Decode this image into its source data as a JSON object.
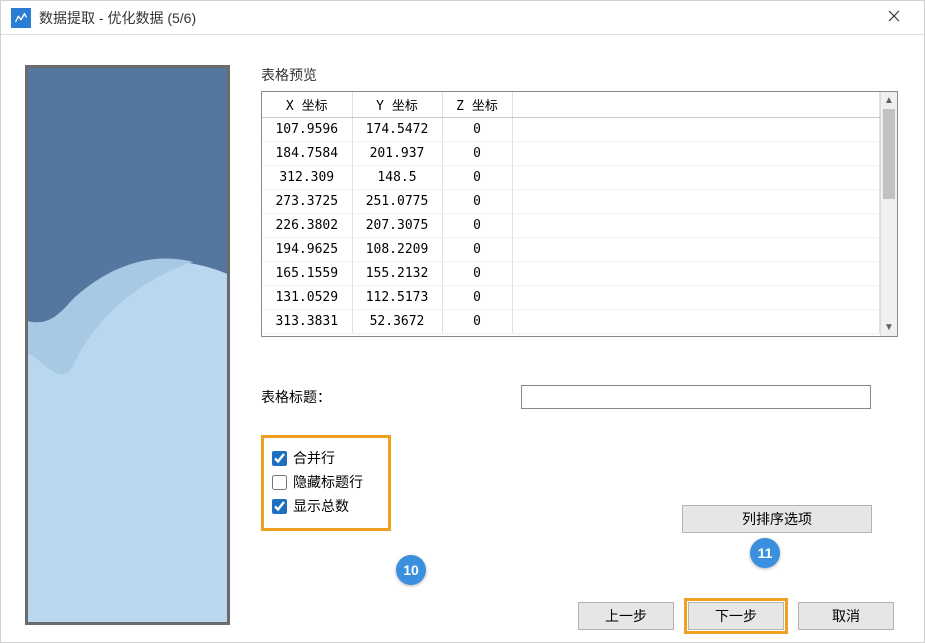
{
  "window": {
    "title": "数据提取 - 优化数据 (5/6)"
  },
  "preview": {
    "label": "表格预览"
  },
  "table": {
    "headers": {
      "x": "X 坐标",
      "y": "Y 坐标",
      "z": "Z 坐标"
    },
    "rows": [
      {
        "x": "107.9596",
        "y": "174.5472",
        "z": "0"
      },
      {
        "x": "184.7584",
        "y": "201.937",
        "z": "0"
      },
      {
        "x": "312.309",
        "y": "148.5",
        "z": "0"
      },
      {
        "x": "273.3725",
        "y": "251.0775",
        "z": "0"
      },
      {
        "x": "226.3802",
        "y": "207.3075",
        "z": "0"
      },
      {
        "x": "194.9625",
        "y": "108.2209",
        "z": "0"
      },
      {
        "x": "165.1559",
        "y": "155.2132",
        "z": "0"
      },
      {
        "x": "131.0529",
        "y": "112.5173",
        "z": "0"
      },
      {
        "x": "313.3831",
        "y": "52.3672",
        "z": "0"
      }
    ]
  },
  "form": {
    "title_label": "表格标题：",
    "title_value": ""
  },
  "checks": {
    "merge_rows": {
      "label": "合并行",
      "checked": true
    },
    "hide_header": {
      "label": "隐藏标题行",
      "checked": false
    },
    "show_total": {
      "label": "显示总数",
      "checked": true
    }
  },
  "buttons": {
    "sort": "列排序选项",
    "prev": "上一步",
    "next": "下一步",
    "cancel": "取消"
  },
  "callouts": {
    "c10": "10",
    "c11": "11"
  }
}
